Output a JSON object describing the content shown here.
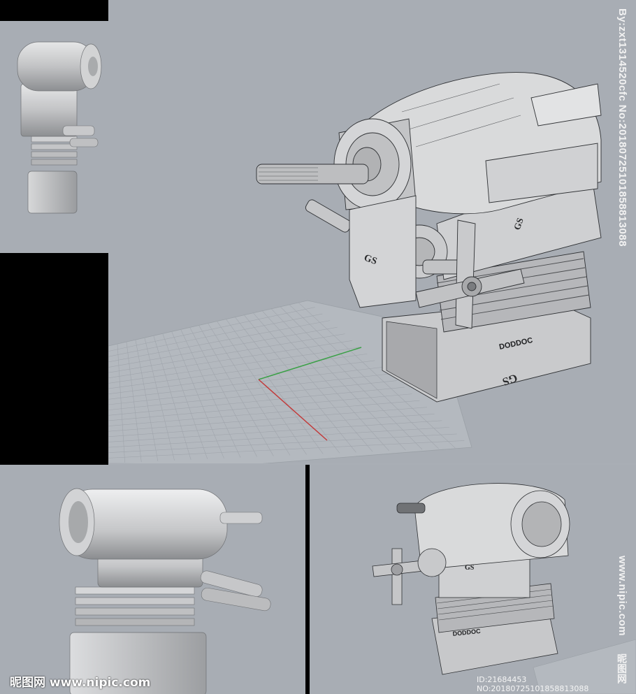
{
  "watermarks": {
    "vertical_id": "By:zxt1314520cfc No:20180725101858813088",
    "vertical_site": "www.nipic.com",
    "vertical_brand": "昵图网",
    "footer_brand": "昵图网 www.nipic.com",
    "footer_id": "ID:21684453 NO:20180725101858813088"
  },
  "engine_markings": {
    "brand_label": "GS",
    "plate_label": "DODDOC"
  },
  "colors": {
    "viewport_bg": "#a8adb4",
    "frame_black": "#000000",
    "grid_line": "#9da2a9",
    "axis_x": "#c23a3a",
    "axis_y": "#3aa046",
    "metal_light": "#d9dadb",
    "metal_mid": "#b7b8ba",
    "metal_dark": "#7c7e81"
  }
}
